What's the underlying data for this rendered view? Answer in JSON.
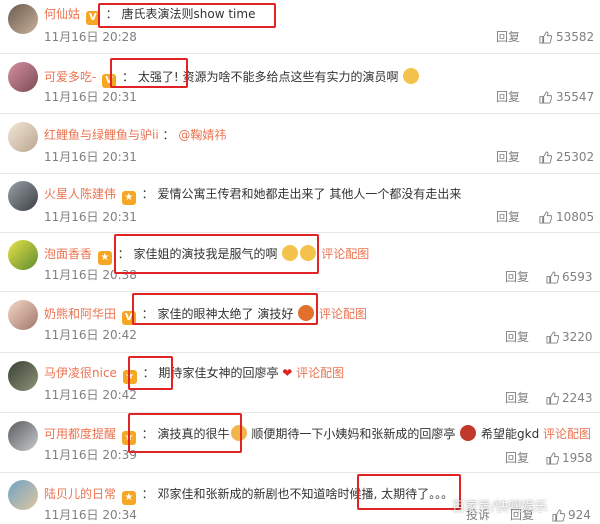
{
  "comments": [
    {
      "username": "何仙姑",
      "badge": "V",
      "text": "唐氏表演法则show time",
      "date": "11月16日 20:28",
      "reply": "回复",
      "likes": "53582"
    },
    {
      "username": "可爱多吃-",
      "badge": "V",
      "text_boxed": "太强了!",
      "text": "资源为啥不能多给点这些有实力的演员啊",
      "date": "11月16日 20:31",
      "reply": "回复",
      "likes": "35547"
    },
    {
      "username": "红鲤鱼与绿鲤鱼与驴ii",
      "text": "@鞠婧祎",
      "date": "11月16日 20:31",
      "reply": "回复",
      "likes": "25302"
    },
    {
      "username": "火星人陈建伟",
      "badge": "★",
      "text": "爱情公寓王传君和她都走出来了 其他人一个都没有走出来",
      "date": "11月16日 20:31",
      "reply": "回复",
      "likes": "10805"
    },
    {
      "username": "泡面香香",
      "badge": "★",
      "text": "家佳姐的演技我是服气的啊",
      "link": "评论配图",
      "date": "11月16日 20:38",
      "reply": "回复",
      "likes": "6593"
    },
    {
      "username": "奶熊和阿华田",
      "badge": "V",
      "text": "家佳的眼神太绝了 演技好",
      "link": "评论配图",
      "date": "11月16日 20:42",
      "reply": "回复",
      "likes": "3220"
    },
    {
      "username": "马伊凌很nice",
      "badge": "★",
      "text_boxed": "期待",
      "text": "家佳女神的回廖亭",
      "link": "评论配图",
      "date": "11月16日 20:42",
      "reply": "回复",
      "likes": "2243"
    },
    {
      "username": "可用都度提醒",
      "badge": "★",
      "text_boxed": "演技真的很牛",
      "text": "顺便期待一下小姨妈和张新成的回廖亭",
      "text2": "希望能gkd",
      "link": "评论配图",
      "date": "11月16日 20:39",
      "reply": "回复",
      "likes": "1958"
    },
    {
      "username": "陆贝儿的日常",
      "badge": "★",
      "text": "邓家佳和张新成的新剧也不知道啥时候播,",
      "text_boxed": "太期待了。。。",
      "date": "11月16日 20:34",
      "reply": "投诉",
      "reply2": "回复",
      "likes": "924"
    }
  ],
  "watermark": "百家号/快嘿娱乐",
  "colors": {
    "username": "#eb7350",
    "highlight_box": "#e02424",
    "meta": "#808080"
  }
}
